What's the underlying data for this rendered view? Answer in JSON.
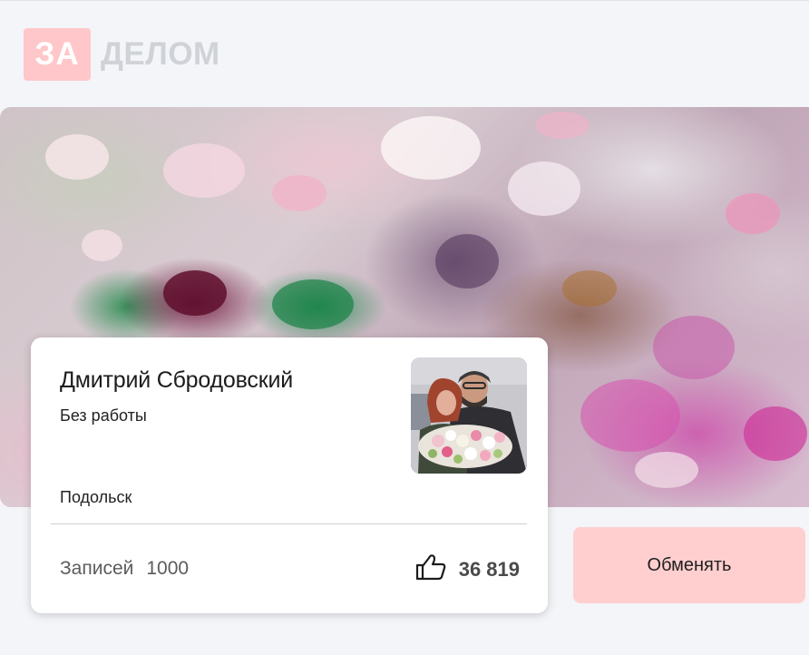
{
  "header": {
    "logo_mark": "ЗА",
    "logo_text": "ДЕЛОМ"
  },
  "profile": {
    "name": "Дмитрий Сбродовский",
    "status": "Без работы",
    "city": "Подольск",
    "posts_label": "Записей",
    "posts_count": "1000",
    "likes_count": "36 819"
  },
  "actions": {
    "exchange_label": "Обменять"
  },
  "icons": {
    "likes": "thumbs-up-icon"
  },
  "colors": {
    "logo_mark_bg": "#ffc7c9",
    "logo_text": "#cfd2d7",
    "exchange_button_bg": "#ffcfcf",
    "page_bg": "#f3f5f8"
  }
}
